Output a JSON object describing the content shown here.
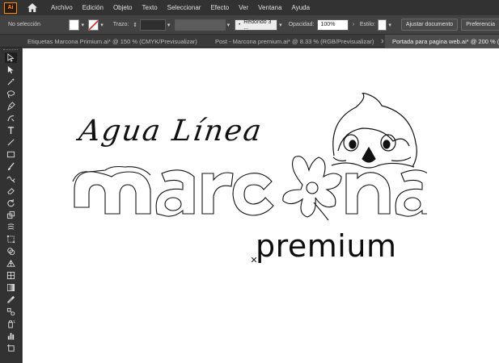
{
  "app": {
    "logo_text": "Ai"
  },
  "menu": [
    "Archivo",
    "Edición",
    "Objeto",
    "Texto",
    "Seleccionar",
    "Efecto",
    "Ver",
    "Ventana",
    "Ayuda"
  ],
  "control_bar": {
    "selection_status": "No selección",
    "stroke_label": "Trazo:",
    "brush_label": "Redondo 3 ...",
    "opacity_label": "Opacidad:",
    "opacity_value": "100%",
    "style_label": "Estilo:",
    "fit_document_button": "Ajustar documento",
    "preferences_button": "Preferencia"
  },
  "tabs": [
    {
      "label": "Etiquetas Marcona Primium.ai* @ 150 % (CMYK/Previsualizar)",
      "active": false
    },
    {
      "label": "Post - Marcona premium.ai* @ 8.33 % (RGB/Previsualizar)",
      "active": false
    },
    {
      "label": "Portada para pagina web.ai* @ 200 % (",
      "active": true
    }
  ],
  "artwork": {
    "tagline": "Agua Línea",
    "brand": "marcona",
    "subbrand": "premium"
  },
  "colors": {
    "menubar": "#323232",
    "controlbar": "#424242",
    "canvas": "#ffffff",
    "app_accent": "#ff8a1c"
  },
  "tools": [
    "selection-tool",
    "direct-selection-tool",
    "magic-wand-tool",
    "lasso-tool",
    "pen-tool",
    "curvature-tool",
    "type-tool",
    "line-tool",
    "rectangle-tool",
    "paintbrush-tool",
    "shaper-tool",
    "eraser-tool",
    "rotate-tool",
    "scale-tool",
    "warp-tool",
    "free-transform-tool",
    "shape-builder-tool",
    "perspective-grid-tool",
    "mesh-tool",
    "gradient-tool",
    "eyedropper-tool",
    "blend-tool",
    "symbol-sprayer-tool",
    "column-graph-tool",
    "artboard-tool"
  ]
}
